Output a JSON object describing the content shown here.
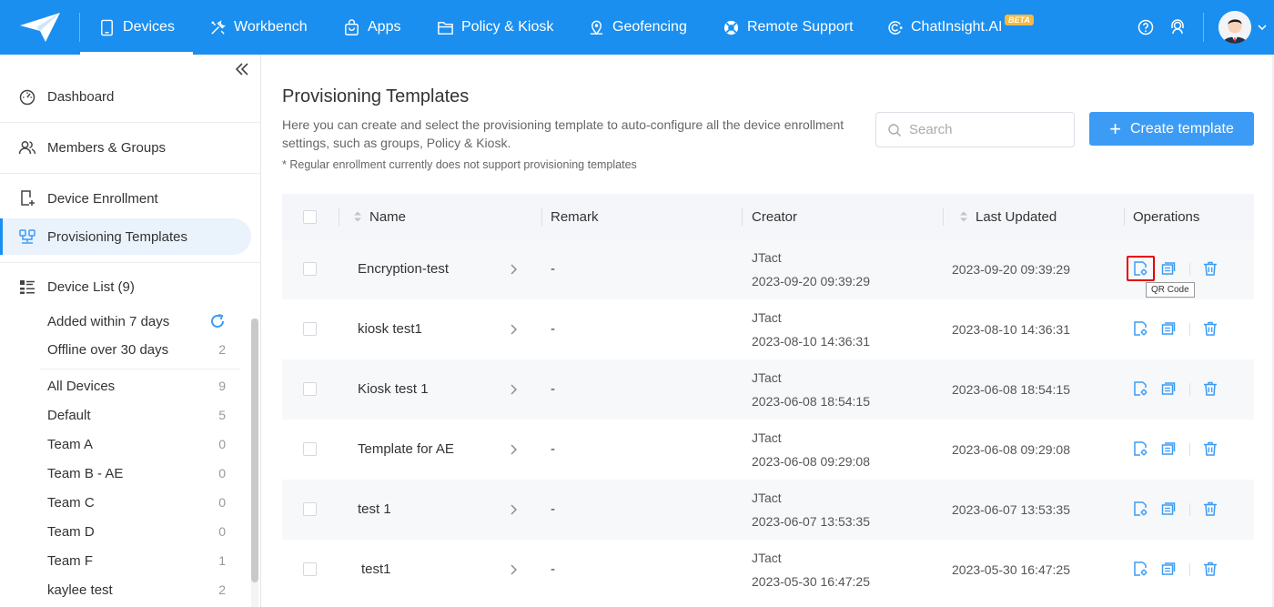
{
  "nav": {
    "items": [
      {
        "label": "Devices",
        "icon": "phone-icon"
      },
      {
        "label": "Workbench",
        "icon": "tools-icon"
      },
      {
        "label": "Apps",
        "icon": "bag-icon"
      },
      {
        "label": "Policy & Kiosk",
        "icon": "folder-icon"
      },
      {
        "label": "Geofencing",
        "icon": "map-pin-icon"
      },
      {
        "label": "Remote Support",
        "icon": "lifebuoy-icon"
      },
      {
        "label": "ChatInsight.AI",
        "icon": "ai-chat-icon"
      }
    ],
    "beta_badge": "BETA",
    "brand_color": "#1a8ff0"
  },
  "sidebar": {
    "items": [
      {
        "label": "Dashboard",
        "icon": "dashboard-icon"
      },
      {
        "label": "Members & Groups",
        "icon": "users-icon"
      },
      {
        "label": "Device Enrollment",
        "icon": "enroll-icon"
      },
      {
        "label": "Provisioning Templates",
        "icon": "template-icon"
      },
      {
        "label": "Device List (9)",
        "icon": "list-icon"
      }
    ],
    "groups": [
      {
        "label": "Added within 7 days",
        "count": ""
      },
      {
        "label": "Offline over 30 days",
        "count": "2"
      },
      {
        "label": "All Devices",
        "count": "9"
      },
      {
        "label": "Default",
        "count": "5"
      },
      {
        "label": "Team A",
        "count": "0"
      },
      {
        "label": "Team B - AE",
        "count": "0"
      },
      {
        "label": "Team C",
        "count": "0"
      },
      {
        "label": "Team D",
        "count": "0"
      },
      {
        "label": "Team F",
        "count": "1"
      },
      {
        "label": "kaylee test",
        "count": "2"
      }
    ]
  },
  "main": {
    "title": "Provisioning Templates",
    "description": "Here you can create and select the provisioning template to auto-configure all the device enrollment settings, such as groups, Policy & Kiosk.",
    "note": "* Regular enrollment currently does not support provisioning templates",
    "search_placeholder": "Search",
    "create_label": "Create template",
    "columns": {
      "name": "Name",
      "remark": "Remark",
      "creator": "Creator",
      "updated": "Last Updated",
      "operations": "Operations"
    },
    "tooltip": "QR Code",
    "rows": [
      {
        "name": "Encryption-test",
        "remark": "-",
        "creator": "JTact",
        "created": "2023-09-20 09:39:29",
        "updated": "2023-09-20 09:39:29"
      },
      {
        "name": "kiosk test1",
        "remark": "-",
        "creator": "JTact",
        "created": "2023-08-10 14:36:31",
        "updated": "2023-08-10 14:36:31"
      },
      {
        "name": "Kiosk test 1",
        "remark": "-",
        "creator": "JTact",
        "created": "2023-06-08 18:54:15",
        "updated": "2023-06-08 18:54:15"
      },
      {
        "name": "Template for AE",
        "remark": "-",
        "creator": "JTact",
        "created": "2023-06-08 09:29:08",
        "updated": "2023-06-08 09:29:08"
      },
      {
        "name": "test 1",
        "remark": "-",
        "creator": "JTact",
        "created": "2023-06-07 13:53:35",
        "updated": "2023-06-07 13:53:35"
      },
      {
        "name": "test1",
        "remark": "-",
        "creator": "JTact",
        "created": "2023-05-30 16:47:25",
        "updated": "2023-05-30 16:47:25"
      }
    ]
  }
}
